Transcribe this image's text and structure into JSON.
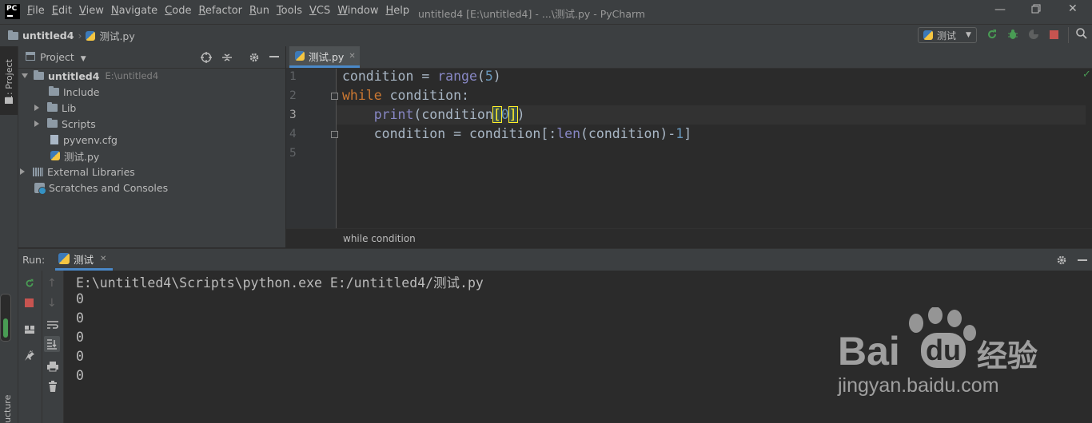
{
  "app": {
    "logo_text": "PC",
    "window_title": "untitled4 [E:\\untitled4] - ...\\测试.py - PyCharm",
    "menu": [
      "File",
      "Edit",
      "View",
      "Navigate",
      "Code",
      "Refactor",
      "Run",
      "Tools",
      "VCS",
      "Window",
      "Help"
    ]
  },
  "navbar": {
    "project": "untitled4",
    "file": "测试.py",
    "run_config": "测试"
  },
  "left_strip": {
    "project_tab": "1: Project",
    "structure_tab": "ucture"
  },
  "project_panel": {
    "title": "Project",
    "tree": [
      {
        "label": "untitled4",
        "path": "E:\\untitled4"
      },
      {
        "label": "Include"
      },
      {
        "label": "Lib"
      },
      {
        "label": "Scripts"
      },
      {
        "label": "pyvenv.cfg"
      },
      {
        "label": "测试.py"
      },
      {
        "label": "External Libraries"
      },
      {
        "label": "Scratches and Consoles"
      }
    ]
  },
  "editor": {
    "tab": "测试.py",
    "line_numbers": [
      "1",
      "2",
      "3",
      "4",
      "5"
    ],
    "breadcrumb": "while condition"
  },
  "code": {
    "l1_a": "condition = ",
    "l1_b": "range",
    "l1_c": "(",
    "l1_d": "5",
    "l1_e": ")",
    "l2_a": "while",
    "l2_b": " condition:",
    "l3_indent": "    ",
    "l3_a": "print",
    "l3_b": "(condition",
    "l3_c": "[",
    "l3_d": "0",
    "l3_e": "]",
    "l3_f": ")",
    "l4_a": "    condition = condition[:",
    "l4_b": "len",
    "l4_c": "(condition)-",
    "l4_d": "1",
    "l4_e": "]"
  },
  "run": {
    "label": "Run:",
    "tab": "测试",
    "output": [
      "E:\\untitled4\\Scripts\\python.exe E:/untitled4/测试.py",
      "0",
      "0",
      "0",
      "0",
      "0"
    ]
  },
  "watermark": {
    "brand": "Bai",
    "brand2": "du",
    "cn": "经验",
    "url": "jingyan.baidu.com"
  },
  "colors": {
    "accent": "#4a88c7",
    "keyword": "#cc7832",
    "builtin": "#8888c6",
    "number": "#6897bb",
    "run_green": "#499c54",
    "stop_red": "#c75450"
  }
}
